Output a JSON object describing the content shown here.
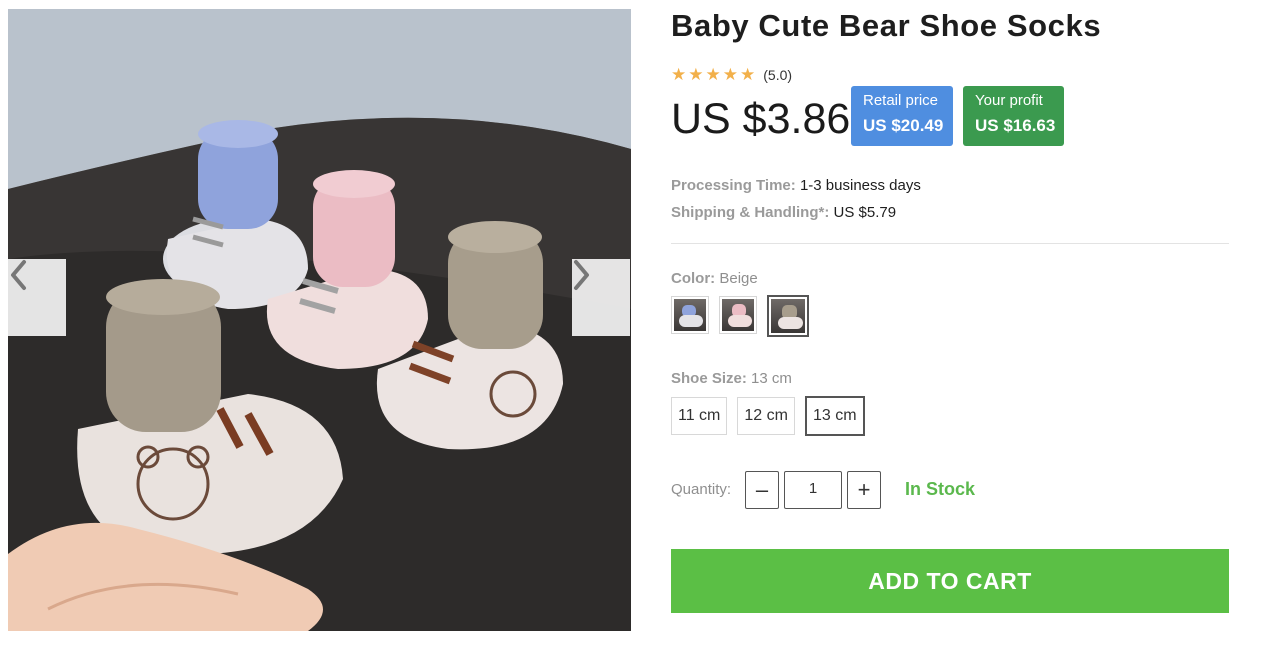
{
  "product": {
    "title": "Baby Cute Bear Shoe Socks",
    "rating_value": "(5.0)",
    "rating_stars": 5,
    "price": "US $3.86",
    "retail": {
      "label": "Retail price",
      "value": "US $20.49"
    },
    "profit": {
      "label": "Your profit",
      "value": "US $16.63"
    },
    "processing": {
      "label": "Processing Time:",
      "value": "1-3 business days"
    },
    "shipping": {
      "label": "Shipping & Handling*:",
      "value": "US $5.79"
    }
  },
  "color": {
    "label": "Color:",
    "selected": "Beige",
    "options": [
      "Blue",
      "Pink",
      "Beige"
    ]
  },
  "size": {
    "label": "Shoe Size:",
    "selected": "13 cm",
    "options": [
      "11 cm",
      "12 cm",
      "13 cm"
    ]
  },
  "quantity": {
    "label": "Quantity:",
    "value": "1",
    "minus_icon": "minus-icon",
    "plus_icon": "plus-icon"
  },
  "stock_status": "In Stock",
  "cart_button": "ADD TO CART",
  "gallery": {
    "prev_icon": "chevron-left-icon",
    "next_icon": "chevron-right-icon"
  },
  "colors": {
    "retail_badge": "#4f8ee0",
    "profit_badge": "#3b9a4f",
    "stock_green": "#5bb84d",
    "cart_green": "#5bbf45",
    "star": "#f2b04a"
  }
}
